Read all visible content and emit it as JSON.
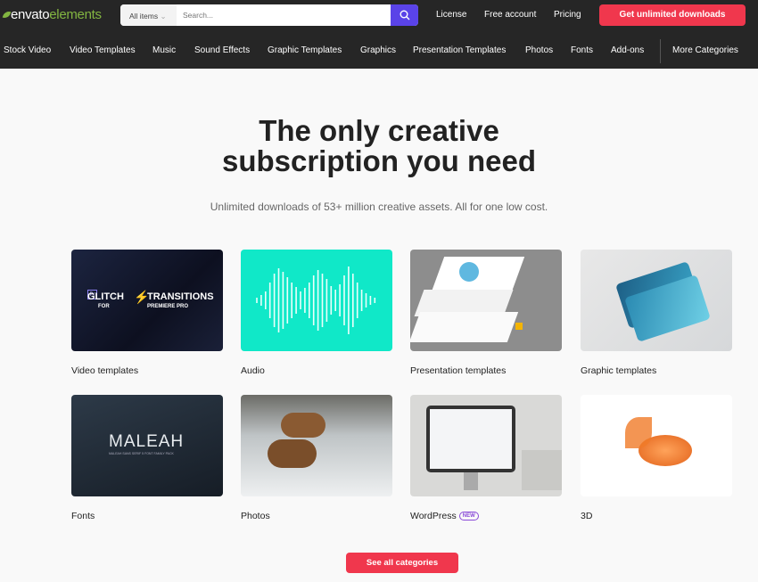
{
  "header": {
    "logo_main": "envato",
    "logo_sub": "elements",
    "search_category": "All items",
    "search_placeholder": "Search...",
    "links": [
      "License",
      "Free account",
      "Pricing"
    ],
    "cta": "Get unlimited downloads"
  },
  "nav": [
    "Stock Video",
    "Video Templates",
    "Music",
    "Sound Effects",
    "Graphic Templates",
    "Graphics",
    "Presentation Templates",
    "Photos",
    "Fonts",
    "Add-ons",
    "More Categories"
  ],
  "hero": {
    "title_line1": "The only creative",
    "title_line2": "subscription you need",
    "subtitle": "Unlimited downloads of 53+ million creative assets. All for one low cost."
  },
  "categories": [
    {
      "label": "Video templates",
      "thumb_text": "GLITCH",
      "thumb_text2": "TRANSITIONS",
      "thumb_text3": "FOR",
      "thumb_text4": "PREMIERE PRO"
    },
    {
      "label": "Audio"
    },
    {
      "label": "Presentation templates"
    },
    {
      "label": "Graphic templates"
    },
    {
      "label": "Fonts",
      "thumb_text": "MALEAH",
      "thumb_text2": "MALEAH SANS SERIF 5 FONT FAMILY PACK"
    },
    {
      "label": "Photos"
    },
    {
      "label": "WordPress",
      "badge": "NEW"
    },
    {
      "label": "3D"
    }
  ],
  "see_all": "See all categories",
  "colors": {
    "accent": "#f0374d",
    "search": "#5a43e8",
    "brand": "#82b541"
  }
}
